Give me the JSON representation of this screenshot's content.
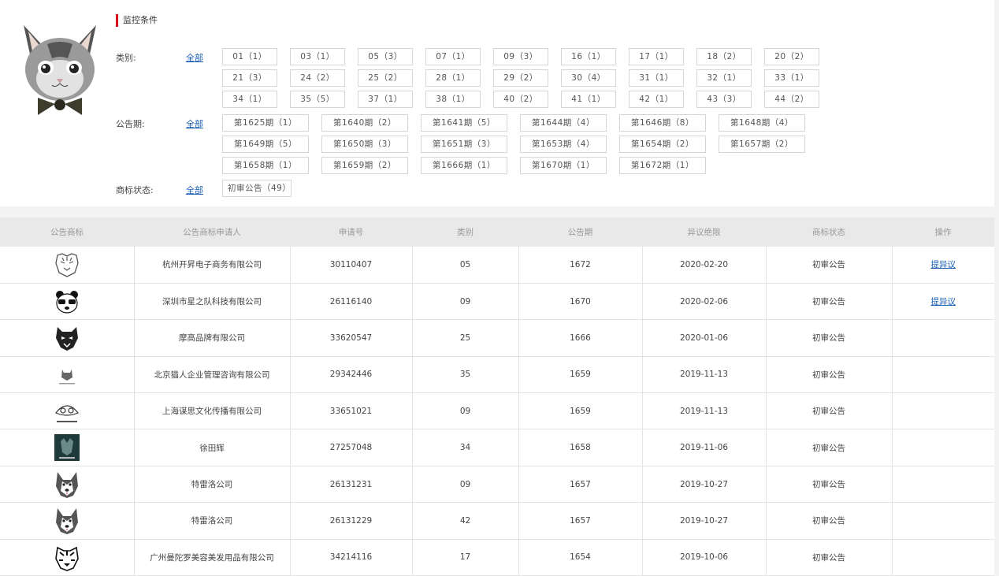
{
  "monitor": {
    "title": "监控条件",
    "category_label": "类别:",
    "issue_label": "公告期:",
    "status_label": "商标状态:",
    "all_label": "全部",
    "categories": [
      "01（1）",
      "03（1）",
      "05（3）",
      "07（1）",
      "09（3）",
      "16（1）",
      "17（1）",
      "18（2）",
      "20（2）",
      "21（3）",
      "24（2）",
      "25（2）",
      "28（1）",
      "29（2）",
      "30（4）",
      "31（1）",
      "32（1）",
      "33（1）",
      "34（1）",
      "35（5）",
      "37（1）",
      "38（1）",
      "40（2）",
      "41（1）",
      "42（1）",
      "43（3）",
      "44（2）"
    ],
    "issues": [
      "第1625期（1）",
      "第1640期（2）",
      "第1641期（5）",
      "第1644期（4）",
      "第1646期（8）",
      "第1648期（4）",
      "第1649期（5）",
      "第1650期（3）",
      "第1651期（3）",
      "第1653期（4）",
      "第1654期（2）",
      "第1657期（2）",
      "第1658期（1）",
      "第1659期（2）",
      "第1666期（1）",
      "第1670期（1）",
      "第1672期（1）"
    ],
    "statuses": [
      "初审公告（49）"
    ]
  },
  "table": {
    "headers": [
      "公告商标",
      "公告商标申请人",
      "申请号",
      "类别",
      "公告期",
      "异议绝限",
      "商标状态",
      "操作"
    ],
    "rows": [
      {
        "icon": "tiger-line-icon",
        "applicant": "杭州开昇电子商务有限公司",
        "reg_no": "30110407",
        "category": "05",
        "issue": "1672",
        "deadline": "2020-02-20",
        "status": "初审公告",
        "action": "提异议"
      },
      {
        "icon": "panda-sunglasses-icon",
        "applicant": "深圳市星之队科技有限公司",
        "reg_no": "26116140",
        "category": "09",
        "issue": "1670",
        "deadline": "2020-02-06",
        "status": "初审公告",
        "action": "提异议"
      },
      {
        "icon": "wolf-head-icon",
        "applicant": "摩高品牌有限公司",
        "reg_no": "33620547",
        "category": "25",
        "issue": "1666",
        "deadline": "2020-01-06",
        "status": "初审公告",
        "action": ""
      },
      {
        "icon": "cat-small-icon",
        "applicant": "北京猫人企业管理咨询有限公司",
        "reg_no": "29342446",
        "category": "35",
        "issue": "1659",
        "deadline": "2019-11-13",
        "status": "初审公告",
        "action": ""
      },
      {
        "icon": "raccoon-icon",
        "applicant": "上海谋思文化传播有限公司",
        "reg_no": "33651021",
        "category": "09",
        "issue": "1659",
        "deadline": "2019-11-13",
        "status": "初审公告",
        "action": ""
      },
      {
        "icon": "dark-poster-icon",
        "applicant": "徐田辉",
        "reg_no": "27257048",
        "category": "34",
        "issue": "1658",
        "deadline": "2019-11-06",
        "status": "初审公告",
        "action": ""
      },
      {
        "icon": "husky-icon",
        "applicant": "特雷洛公司",
        "reg_no": "26131231",
        "category": "09",
        "issue": "1657",
        "deadline": "2019-10-27",
        "status": "初审公告",
        "action": ""
      },
      {
        "icon": "husky-icon",
        "applicant": "特雷洛公司",
        "reg_no": "26131229",
        "category": "42",
        "issue": "1657",
        "deadline": "2019-10-27",
        "status": "初审公告",
        "action": ""
      },
      {
        "icon": "tiger-face-icon",
        "applicant": "广州曼陀罗美容美发用品有限公司",
        "reg_no": "34214116",
        "category": "17",
        "issue": "1654",
        "deadline": "2019-10-06",
        "status": "初审公告",
        "action": ""
      }
    ]
  }
}
